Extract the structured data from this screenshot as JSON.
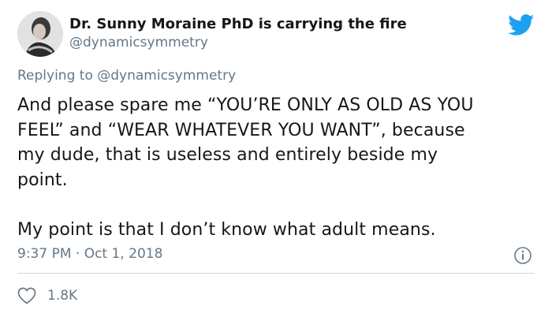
{
  "tweet": {
    "author": {
      "display_name": "Dr. Sunny Moraine PhD is carrying the fire",
      "handle": "@dynamicsymmetry"
    },
    "replying": {
      "prefix": "Replying to ",
      "mention": "@dynamicsymmetry"
    },
    "text": "And please spare me “YOU’RE ONLY AS OLD AS YOU\nFEEL” and “WEAR WHATEVER YOU WANT”, because\nmy dude, that is useless and entirely beside my\npoint.\n\nMy point is that I don’t know what adult means.",
    "timestamp": "9:37 PM · Oct 1, 2018",
    "likes": "1.8K"
  },
  "icons": {
    "brand": "twitter-bird-icon",
    "info": "info-icon",
    "like": "heart-icon"
  },
  "colors": {
    "brand_blue": "#1da1f2",
    "text_primary": "#14171a",
    "text_secondary": "#657786",
    "divider": "#ccd6dd"
  }
}
